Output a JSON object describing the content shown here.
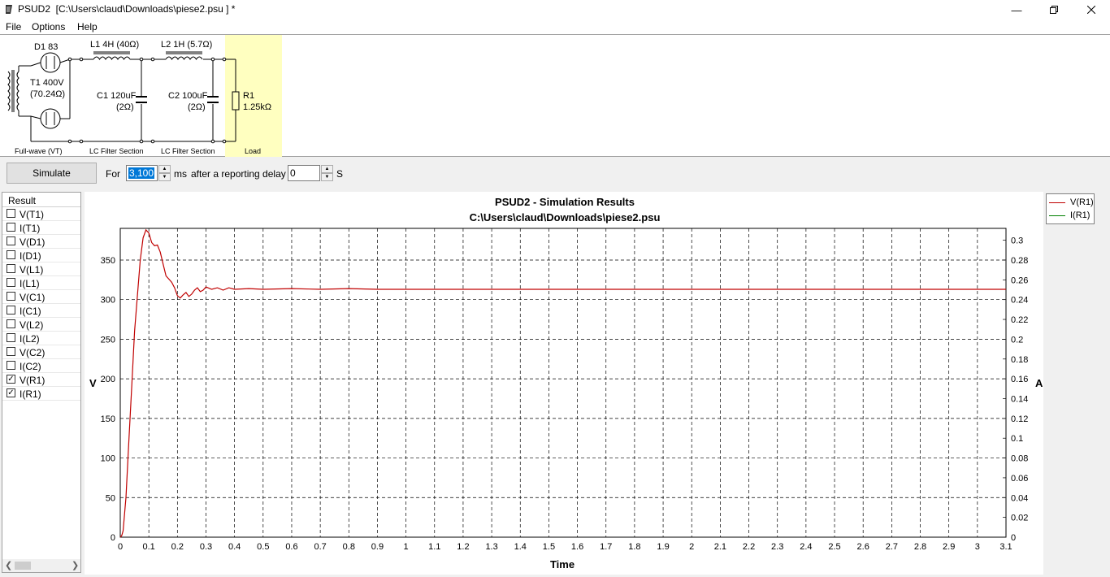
{
  "window": {
    "app_name": "PSUD2",
    "title": "PSUD2  [C:\\Users\\claud\\Downloads\\piese2.psu ] *",
    "minimize_icon": "minimize-icon",
    "maximize_icon": "restore-icon",
    "close_icon": "close-icon"
  },
  "menu": [
    "File",
    "Options",
    "Help"
  ],
  "schematic": {
    "d1": "D1 83",
    "t1_line1": "T1 400V",
    "t1_line2": "(70.24Ω)",
    "l1": "L1 4H (40Ω)",
    "l2": "L2 1H (5.7Ω)",
    "c1_line1": "C1 120uF",
    "c1_line2": "(2Ω)",
    "c2_line1": "C2 100uF",
    "c2_line2": "(2Ω)",
    "r1_line1": "R1",
    "r1_line2": "1.25kΩ",
    "section_rectifier": "Full-wave (VT)",
    "section_filter1": "LC Filter Section",
    "section_filter2": "LC Filter Section",
    "section_load": "Load",
    "load_color": "#ffffc0"
  },
  "toolbar": {
    "simulate_label": "Simulate",
    "for_label": "For",
    "duration_value": "3,100",
    "ms_label": "ms",
    "delay_label": "after a reporting delay of",
    "delay_value": "0",
    "s_label": "S"
  },
  "results": {
    "header": "Result",
    "items": [
      {
        "label": "V(T1)",
        "checked": false
      },
      {
        "label": "I(T1)",
        "checked": false
      },
      {
        "label": "V(D1)",
        "checked": false
      },
      {
        "label": "I(D1)",
        "checked": false
      },
      {
        "label": "V(L1)",
        "checked": false
      },
      {
        "label": "I(L1)",
        "checked": false
      },
      {
        "label": "V(C1)",
        "checked": false
      },
      {
        "label": "I(C1)",
        "checked": false
      },
      {
        "label": "V(L2)",
        "checked": false
      },
      {
        "label": "I(L2)",
        "checked": false
      },
      {
        "label": "V(C2)",
        "checked": false
      },
      {
        "label": "I(C2)",
        "checked": false
      },
      {
        "label": "V(R1)",
        "checked": true
      },
      {
        "label": "I(R1)",
        "checked": true
      }
    ]
  },
  "legend": [
    {
      "name": "V(R1)",
      "color": "#c00000"
    },
    {
      "name": "I(R1)",
      "color": "#008000"
    }
  ],
  "chart_data": {
    "type": "line",
    "title": "PSUD2 - Simulation Results",
    "subtitle": "C:\\Users\\claud\\Downloads\\piese2.psu",
    "xlabel": "Time",
    "ylabel": "V",
    "y2label": "A",
    "xlim": [
      0,
      3.1
    ],
    "ylim": [
      0,
      390
    ],
    "y2lim": [
      0,
      0.312
    ],
    "x_ticks": [
      "0",
      "0.1",
      "0.2",
      "0.3",
      "0.4",
      "0.5",
      "0.6",
      "0.7",
      "0.8",
      "0.9",
      "1",
      "1.1",
      "1.2",
      "1.3",
      "1.4",
      "1.5",
      "1.6",
      "1.7",
      "1.8",
      "1.9",
      "2",
      "2.1",
      "2.2",
      "2.3",
      "2.4",
      "2.5",
      "2.6",
      "2.7",
      "2.8",
      "2.9",
      "3",
      "3.1"
    ],
    "y_ticks": [
      "0",
      "50",
      "100",
      "150",
      "200",
      "250",
      "300",
      "350"
    ],
    "y2_ticks": [
      "0",
      "0.02",
      "0.04",
      "0.06",
      "0.08",
      "0.1",
      "0.12",
      "0.14",
      "0.16",
      "0.18",
      "0.2",
      "0.22",
      "0.24",
      "0.26",
      "0.28",
      "0.3"
    ],
    "grid": true,
    "legend_position": "top-right",
    "series": [
      {
        "name": "V(R1)",
        "color": "#c00000",
        "x": [
          0,
          0.005,
          0.01,
          0.02,
          0.03,
          0.04,
          0.05,
          0.06,
          0.07,
          0.08,
          0.09,
          0.1,
          0.11,
          0.12,
          0.13,
          0.14,
          0.15,
          0.16,
          0.17,
          0.18,
          0.19,
          0.2,
          0.21,
          0.22,
          0.23,
          0.24,
          0.25,
          0.26,
          0.27,
          0.28,
          0.29,
          0.3,
          0.32,
          0.34,
          0.36,
          0.38,
          0.4,
          0.45,
          0.5,
          0.6,
          0.7,
          0.8,
          0.9,
          1.0,
          1.5,
          2.0,
          2.5,
          3.0,
          3.1
        ],
        "values": [
          0,
          2,
          8,
          50,
          120,
          190,
          260,
          305,
          350,
          378,
          388,
          384,
          372,
          368,
          369,
          360,
          345,
          330,
          326,
          322,
          315,
          305,
          302,
          306,
          309,
          304,
          307,
          312,
          315,
          310,
          312,
          316,
          313,
          315,
          312,
          315,
          313,
          314,
          313,
          314,
          313,
          314,
          313,
          313,
          313,
          313,
          313,
          313,
          313
        ]
      },
      {
        "name": "I(R1)",
        "color": "#008000",
        "x": [
          0,
          0.1,
          0.2,
          0.3,
          0.5,
          1.0,
          2.0,
          3.1
        ],
        "values": [
          0,
          0.31,
          0.244,
          0.253,
          0.25,
          0.25,
          0.25,
          0.25
        ]
      }
    ]
  }
}
